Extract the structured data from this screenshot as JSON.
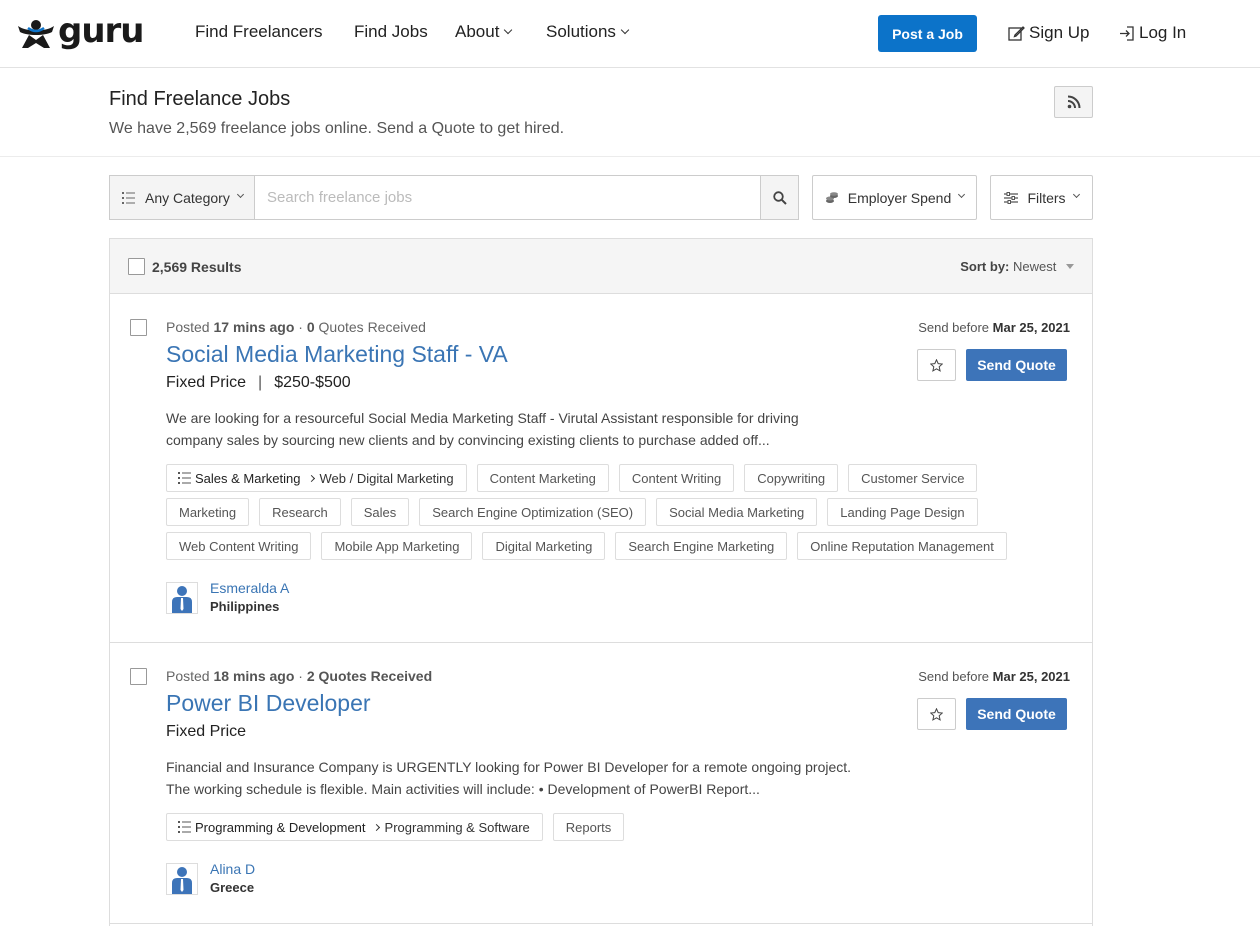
{
  "header": {
    "logo_text": "guru",
    "nav": [
      "Find Freelancers",
      "Find Jobs",
      "About",
      "Solutions"
    ],
    "post_job_label": "Post a Job",
    "signup_label": "Sign Up",
    "login_label": "Log In",
    "accent_color": "#0c73c9"
  },
  "page": {
    "title": "Find Freelance Jobs",
    "subtitle": "We have 2,569 freelance jobs online. Send a Quote to get hired."
  },
  "search": {
    "category_label": "Any Category",
    "placeholder": "Search freelance jobs",
    "employer_spend_label": "Employer Spend",
    "filters_label": "Filters"
  },
  "results": {
    "count_label": "2,569 Results",
    "sort_label": "Sort by:",
    "sort_value": "Newest"
  },
  "jobs": [
    {
      "posted_prefix": "Posted",
      "posted_time": "17 mins ago",
      "dot": "·",
      "quotes_count": "0",
      "quotes_label": "Quotes Received",
      "title": "Social Media Marketing Staff - VA",
      "price_type": "Fixed Price",
      "price_sep": "|",
      "price_range": "$250-$500",
      "description": "We are looking for a resourceful Social Media Marketing Staff - Virutal Assistant responsible for driving company sales by sourcing new clients and by convincing existing clients to purchase added off...",
      "send_before_prefix": "Send before",
      "send_before_date": "Mar 25, 2021",
      "send_quote_label": "Send Quote",
      "category": "Sales & Marketing",
      "subcategory": "Web / Digital Marketing",
      "skills": [
        "Content Marketing",
        "Content Writing",
        "Copywriting",
        "Customer Service",
        "Marketing",
        "Research",
        "Sales",
        "Search Engine Optimization (SEO)",
        "Social Media Marketing",
        "Landing Page Design",
        "Web Content Writing",
        "Mobile App Marketing",
        "Digital Marketing",
        "Search Engine Marketing",
        "Online Reputation Management"
      ],
      "employer_name": "Esmeralda A",
      "employer_country": "Philippines"
    },
    {
      "posted_prefix": "Posted",
      "posted_time": "18 mins ago",
      "dot": "·",
      "quotes_count": "2",
      "quotes_label": "Quotes Received",
      "title": "Power BI Developer",
      "price_type": "Fixed Price",
      "description": "Financial and Insurance Company is URGENTLY looking for Power BI Developer for a remote ongoing project. The working schedule is flexible. Main activities will include: • Development of PowerBI Report...",
      "send_before_prefix": "Send before",
      "send_before_date": "Mar 25, 2021",
      "send_quote_label": "Send Quote",
      "category": "Programming & Development",
      "subcategory": "Programming & Software",
      "skills": [
        "Reports"
      ],
      "employer_name": "Alina D",
      "employer_country": "Greece"
    }
  ]
}
